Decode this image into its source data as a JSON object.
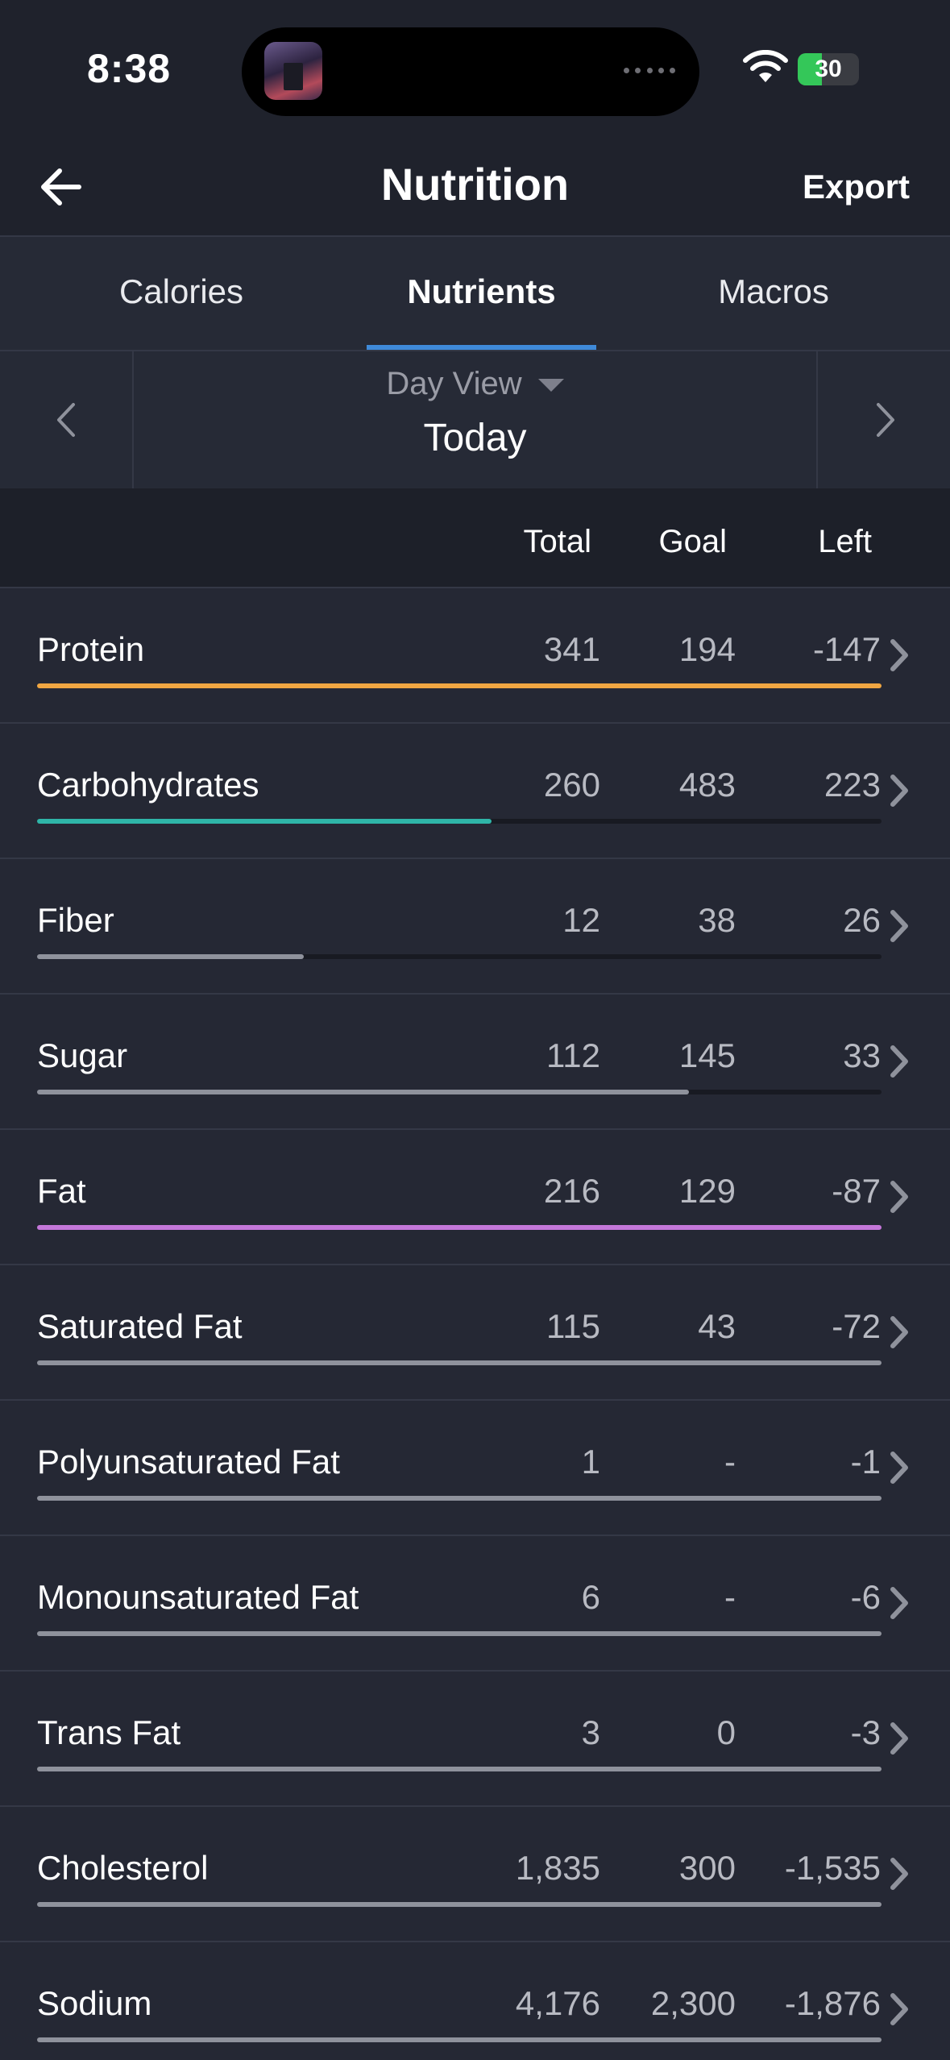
{
  "status": {
    "time": "8:38",
    "battery": "30"
  },
  "header": {
    "title": "Nutrition",
    "export_label": "Export"
  },
  "tabs": [
    {
      "label": "Calories",
      "active": false
    },
    {
      "label": "Nutrients",
      "active": true
    },
    {
      "label": "Macros",
      "active": false
    }
  ],
  "datenav": {
    "view_label": "Day View",
    "date_label": "Today"
  },
  "columns": {
    "total": "Total",
    "goal": "Goal",
    "left": "Left"
  },
  "colors": {
    "accent": "#3f8ad9",
    "protein": "#f0a642",
    "carbs": "#2fb5a8",
    "fat": "#c477d9",
    "neutral": "#8f929c"
  },
  "nutrients": [
    {
      "name": "Protein",
      "total": "341",
      "goal": "194",
      "left": "-147",
      "progress": 1.0,
      "color": "#f0a642"
    },
    {
      "name": "Carbohydrates",
      "total": "260",
      "goal": "483",
      "left": "223",
      "progress": 0.538,
      "color": "#2fb5a8"
    },
    {
      "name": "Fiber",
      "total": "12",
      "goal": "38",
      "left": "26",
      "progress": 0.316,
      "color": "#8f929c"
    },
    {
      "name": "Sugar",
      "total": "112",
      "goal": "145",
      "left": "33",
      "progress": 0.772,
      "color": "#8f929c"
    },
    {
      "name": "Fat",
      "total": "216",
      "goal": "129",
      "left": "-87",
      "progress": 1.0,
      "color": "#c477d9"
    },
    {
      "name": "Saturated Fat",
      "total": "115",
      "goal": "43",
      "left": "-72",
      "progress": 1.0,
      "color": "#8f929c"
    },
    {
      "name": "Polyunsaturated Fat",
      "total": "1",
      "goal": "-",
      "left": "-1",
      "progress": 1.0,
      "color": "#8f929c"
    },
    {
      "name": "Monounsaturated Fat",
      "total": "6",
      "goal": "-",
      "left": "-6",
      "progress": 1.0,
      "color": "#8f929c"
    },
    {
      "name": "Trans Fat",
      "total": "3",
      "goal": "0",
      "left": "-3",
      "progress": 1.0,
      "color": "#8f929c"
    },
    {
      "name": "Cholesterol",
      "total": "1,835",
      "goal": "300",
      "left": "-1,535",
      "progress": 1.0,
      "color": "#8f929c"
    },
    {
      "name": "Sodium",
      "total": "4,176",
      "goal": "2,300",
      "left": "-1,876",
      "progress": 1.0,
      "color": "#8f929c"
    }
  ]
}
